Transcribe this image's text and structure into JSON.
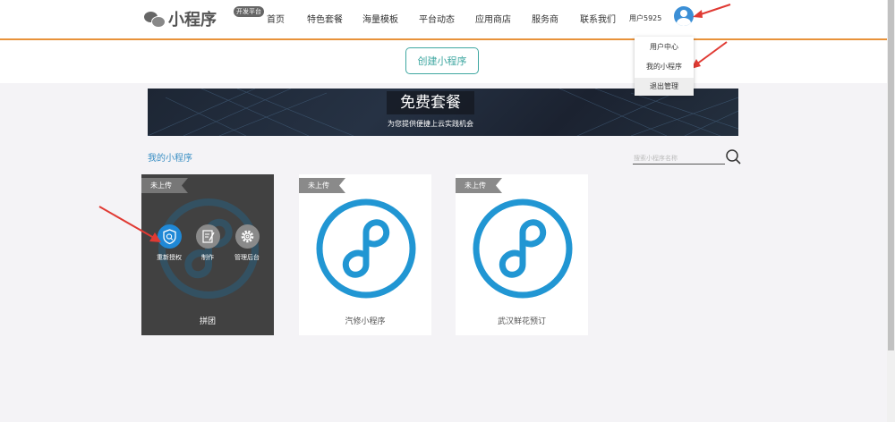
{
  "header": {
    "logo_text": "小程序",
    "logo_badge": "开发平台",
    "nav": [
      "首页",
      "特色套餐",
      "海量模板",
      "平台动态",
      "应用商店",
      "服务商",
      "联系我们"
    ],
    "user_name": "用户5925"
  },
  "dropdown": {
    "items": [
      "用户中心",
      "我的小程序",
      "退出管理"
    ]
  },
  "create_button": "创建小程序",
  "banner": {
    "title": "免费套餐",
    "subtitle": "为您提供便捷上云实践机会"
  },
  "section": {
    "title": "我的小程序",
    "search_placeholder": "搜索小程序名称"
  },
  "cards": [
    {
      "tag": "未上传",
      "name": "拼团",
      "actions": [
        "重新授权",
        "制作",
        "管理后台"
      ],
      "action_icons": [
        "shield-search-icon",
        "edit-icon",
        "gear-icon"
      ]
    },
    {
      "tag": "未上传",
      "name": "汽修小程序"
    },
    {
      "tag": "未上传",
      "name": "武汉鲜花预订"
    }
  ],
  "colors": {
    "accent_orange": "#e8923a",
    "teal": "#3fa7a1",
    "miniprogram_blue": "#2196d3",
    "link_blue": "#3a8fc4",
    "annotation_red": "#e03a33"
  }
}
